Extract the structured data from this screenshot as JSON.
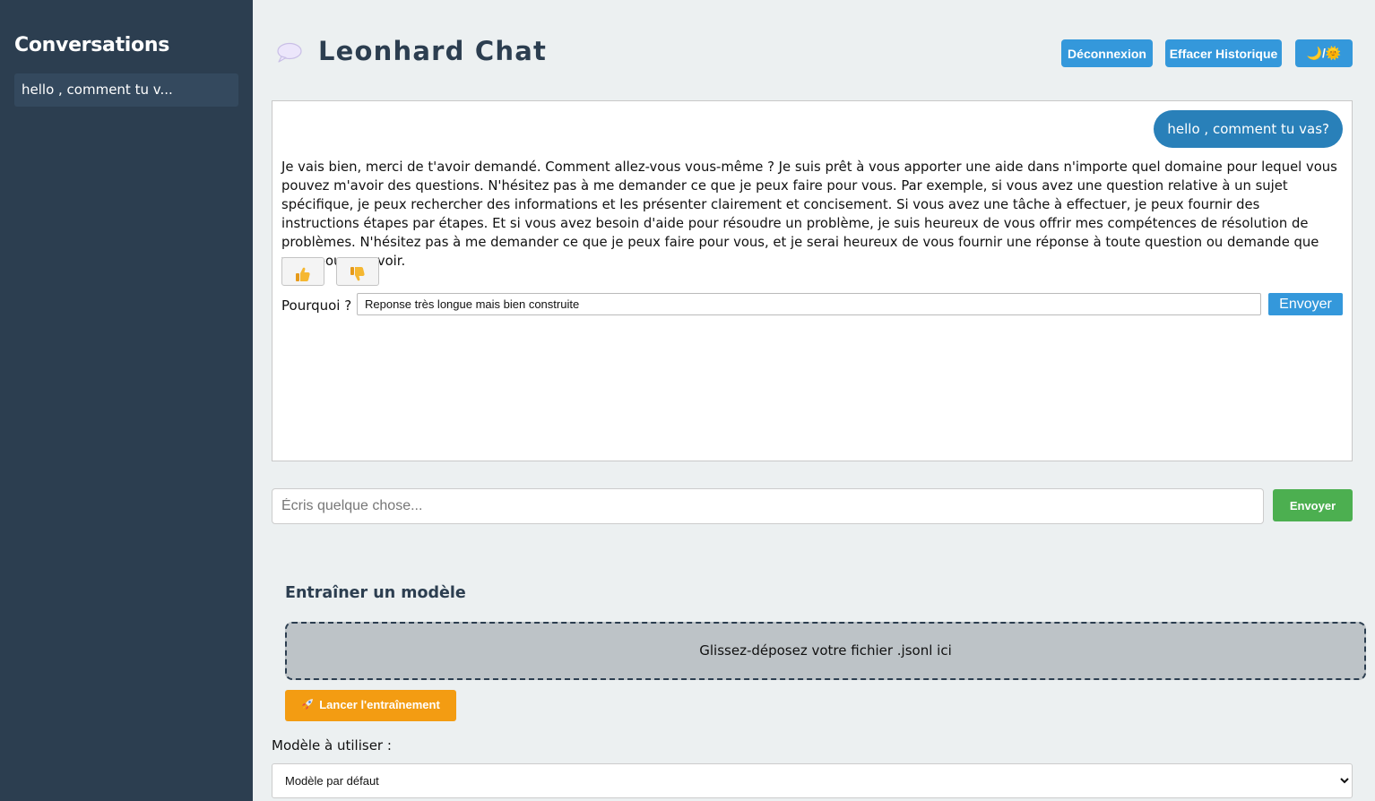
{
  "sidebar": {
    "title": "Conversations",
    "items": [
      {
        "label": "hello , comment tu v..."
      }
    ]
  },
  "header": {
    "title": "Leonhard Chat",
    "logout_label": "Déconnexion",
    "clear_label": "Effacer Historique",
    "theme_label": "🌙/🌞"
  },
  "chat": {
    "user_message": "hello , comment tu vas?",
    "bot_message": "Je vais bien, merci de t'avoir demandé. Comment allez-vous vous-même ? Je suis prêt à vous apporter une aide dans n'importe quel domaine pour lequel vous pouvez m'avoir des questions. N'hésitez pas à me demander ce que je peux faire pour vous. Par exemple, si vous avez une question relative à un sujet spécifique, je peux rechercher des informations et les présenter clairement et concisement. Si vous avez une tâche à effectuer, je peux fournir des instructions étapes par étapes. Et si vous avez besoin d'aide pour résoudre un problème, je suis heureux de vous offrir mes compétences de résolution de problèmes. N'hésitez pas à me demander ce que je peux faire pour vous, et je serai heureux de vous fournir une réponse à toute question ou demande que vous pouvez avoir.",
    "feedback": {
      "up_icon": "thumbs-up-icon",
      "down_icon": "thumbs-down-icon",
      "why_label": "Pourquoi ?",
      "why_value": "Reponse très longue mais bien construite",
      "send_label": "Envoyer"
    }
  },
  "composer": {
    "placeholder": "Écris quelque chose...",
    "value": "",
    "send_label": "Envoyer"
  },
  "training": {
    "title": "Entraîner un modèle",
    "drop_text": "Glissez-déposez votre fichier .jsonl ici",
    "train_label": "Lancer l'entraînement",
    "train_icon": "rocket-icon"
  },
  "model": {
    "label": "Modèle à utiliser :",
    "selected": "Modèle par défaut"
  },
  "colors": {
    "sidebar_bg": "#2c3e50",
    "primary": "#3498db",
    "user_bubble": "#2980b9",
    "send_green": "#4caf50",
    "train_orange": "#f39c12"
  }
}
